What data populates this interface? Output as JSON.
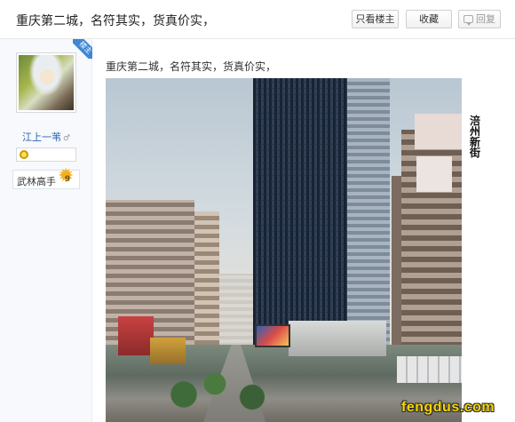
{
  "header": {
    "title": "重庆第二城，名符其实，货真价实，",
    "buttons": {
      "only_op": "只看楼主",
      "favorite": "收藏",
      "reply": "回复"
    }
  },
  "author": {
    "badge": "楼主",
    "username": "江上一苇",
    "gender_symbol": "♂",
    "rank_name": "武林高手",
    "rank_level": "9",
    "avatar": "user-avatar"
  },
  "post": {
    "text": "重庆第二城，名符其实，货真价实，",
    "photo_caption_vertical": "涪州新街",
    "watermark": "fengdus.com"
  },
  "colors": {
    "link": "#2d64b3",
    "op_badge": "#3f86d6",
    "watermark": "#f6d400"
  }
}
